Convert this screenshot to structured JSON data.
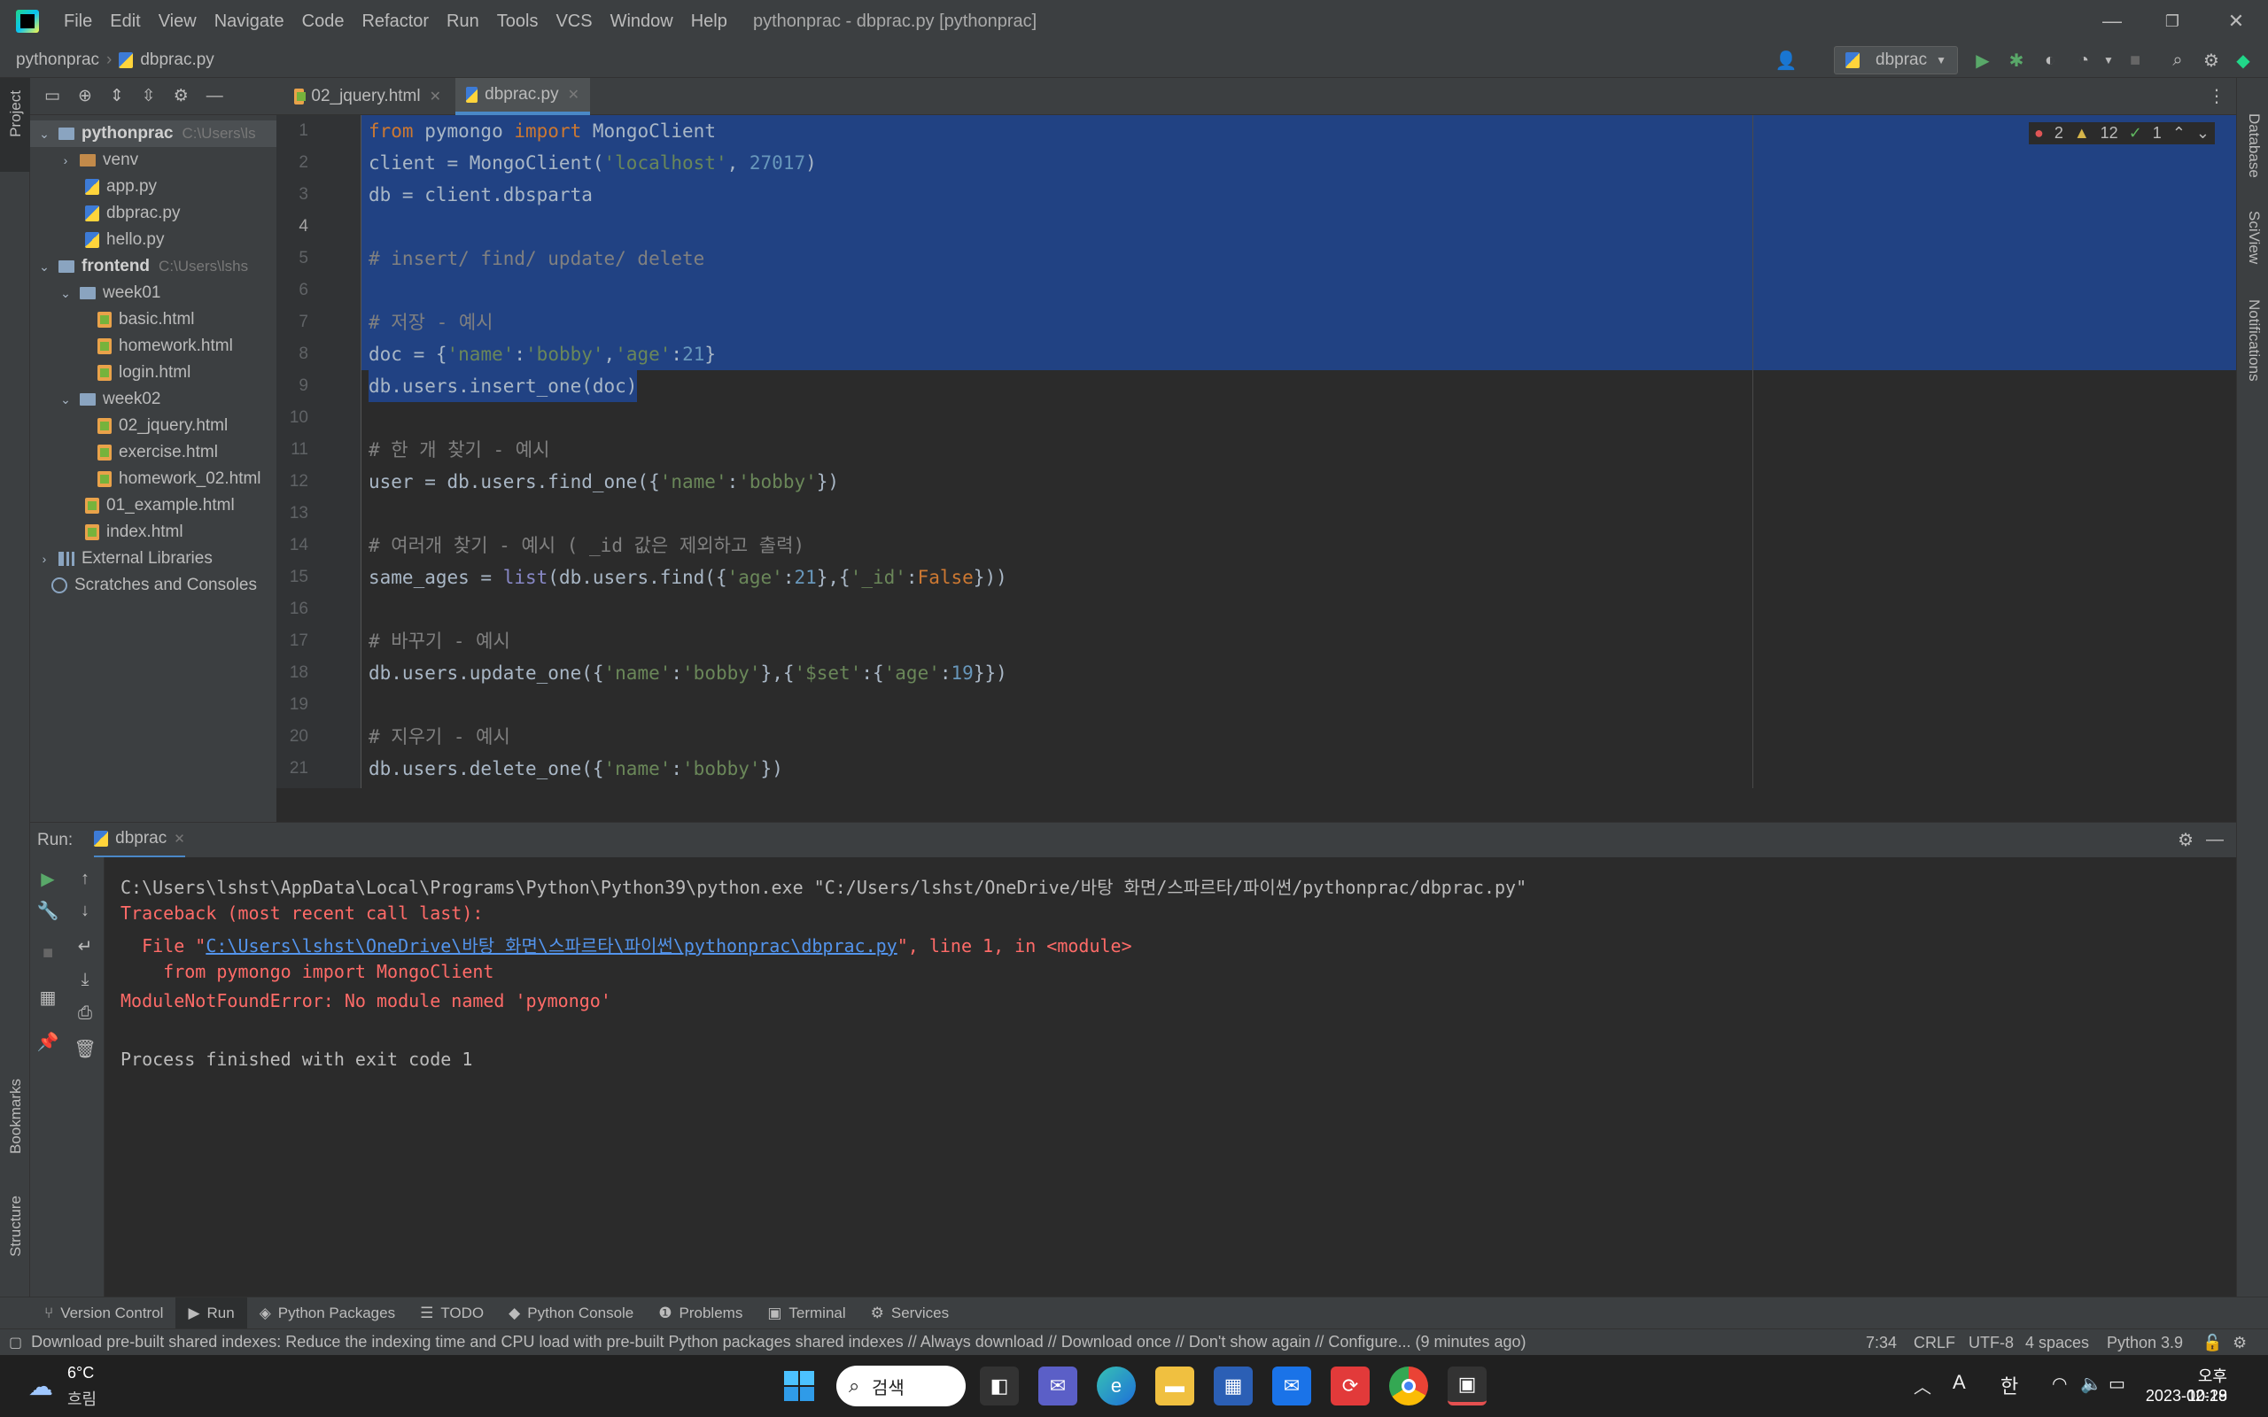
{
  "window": {
    "menu": [
      "File",
      "Edit",
      "View",
      "Navigate",
      "Code",
      "Refactor",
      "Run",
      "Tools",
      "VCS",
      "Window",
      "Help"
    ],
    "title": "pythonprac - dbprac.py [pythonprac]",
    "minimize": "—",
    "restore": "❐",
    "close": "✕"
  },
  "navbar": {
    "project": "pythonprac",
    "separator": "›",
    "file": "dbprac.py",
    "run_config": "dbprac"
  },
  "left_strip": {
    "project": "Project",
    "bookmarks": "Bookmarks",
    "structure": "Structure"
  },
  "right_strip": {
    "database": "Database",
    "sciview": "SciView",
    "notifications": "Notifications"
  },
  "project_tree": [
    {
      "name": "pythonprac",
      "hint": "C:\\Users\\ls",
      "type": "folder",
      "arrow": "v",
      "level": 0,
      "bold": true,
      "selected": true
    },
    {
      "name": "venv",
      "hint": "",
      "type": "folder-orange",
      "arrow": ">",
      "level": 1
    },
    {
      "name": "app.py",
      "hint": "",
      "type": "py",
      "arrow": "",
      "level": 2
    },
    {
      "name": "dbprac.py",
      "hint": "",
      "type": "py",
      "arrow": "",
      "level": 2
    },
    {
      "name": "hello.py",
      "hint": "",
      "type": "py",
      "arrow": "",
      "level": 2
    },
    {
      "name": "frontend",
      "hint": "C:\\Users\\lshs",
      "type": "folder",
      "arrow": "v",
      "level": 0,
      "bold": true
    },
    {
      "name": "week01",
      "hint": "",
      "type": "folder",
      "arrow": "v",
      "level": 1
    },
    {
      "name": "basic.html",
      "hint": "",
      "type": "html",
      "arrow": "",
      "level": 3
    },
    {
      "name": "homework.html",
      "hint": "",
      "type": "html",
      "arrow": "",
      "level": 3
    },
    {
      "name": "login.html",
      "hint": "",
      "type": "html",
      "arrow": "",
      "level": 3
    },
    {
      "name": "week02",
      "hint": "",
      "type": "folder",
      "arrow": "v",
      "level": 1
    },
    {
      "name": "02_jquery.html",
      "hint": "",
      "type": "html",
      "arrow": "",
      "level": 3
    },
    {
      "name": "exercise.html",
      "hint": "",
      "type": "html",
      "arrow": "",
      "level": 3
    },
    {
      "name": "homework_02.html",
      "hint": "",
      "type": "html",
      "arrow": "",
      "level": 3
    },
    {
      "name": "01_example.html",
      "hint": "",
      "type": "html",
      "arrow": "",
      "level": 2
    },
    {
      "name": "index.html",
      "hint": "",
      "type": "html",
      "arrow": "",
      "level": 2
    },
    {
      "name": "External Libraries",
      "hint": "",
      "type": "extlib",
      "arrow": ">",
      "level": 0
    },
    {
      "name": "Scratches and Consoles",
      "hint": "",
      "type": "scratch",
      "arrow": "",
      "level": 0
    }
  ],
  "tabs": [
    {
      "label": "02_jquery.html",
      "active": false
    },
    {
      "label": "dbprac.py",
      "active": true
    }
  ],
  "inspections": {
    "errors": "2",
    "warnings": "12",
    "ok": "1"
  },
  "code_lines": [
    {
      "n": "1",
      "sel": true,
      "tokens": [
        [
          "kw",
          "from "
        ],
        [
          "id",
          "pymongo "
        ],
        [
          "kw",
          "import "
        ],
        [
          "id",
          "MongoClient"
        ]
      ]
    },
    {
      "n": "2",
      "sel": true,
      "tokens": [
        [
          "id",
          "client = MongoClient("
        ],
        [
          "str",
          "'localhost'"
        ],
        [
          "id",
          ", "
        ],
        [
          "num",
          "27017"
        ],
        [
          "id",
          ")"
        ]
      ]
    },
    {
      "n": "3",
      "sel": true,
      "tokens": [
        [
          "id",
          "db = client.dbsparta"
        ]
      ]
    },
    {
      "n": "4",
      "sel": true,
      "tokens": []
    },
    {
      "n": "5",
      "sel": true,
      "tokens": [
        [
          "cm",
          "# insert/ find/ update/ delete"
        ]
      ]
    },
    {
      "n": "6",
      "sel": true,
      "tokens": []
    },
    {
      "n": "7",
      "sel": true,
      "tokens": [
        [
          "cm",
          "# 저장 - 예시"
        ]
      ]
    },
    {
      "n": "8",
      "sel": true,
      "tokens": [
        [
          "id",
          "doc = {"
        ],
        [
          "str",
          "'name'"
        ],
        [
          "id",
          ":"
        ],
        [
          "str",
          "'bobby'"
        ],
        [
          "id",
          ","
        ],
        [
          "str",
          "'age'"
        ],
        [
          "id",
          ":"
        ],
        [
          "num",
          "21"
        ],
        [
          "id",
          "}"
        ]
      ]
    },
    {
      "n": "9",
      "sel": "partial",
      "tokens": [
        [
          "id",
          "db.users.insert_one(doc)"
        ]
      ]
    },
    {
      "n": "10",
      "sel": false,
      "tokens": []
    },
    {
      "n": "11",
      "sel": false,
      "tokens": [
        [
          "cm",
          "# 한 개 찾기 - 예시"
        ]
      ]
    },
    {
      "n": "12",
      "sel": false,
      "tokens": [
        [
          "id",
          "user = db.users.find_one({"
        ],
        [
          "str",
          "'name'"
        ],
        [
          "id",
          ":"
        ],
        [
          "str",
          "'bobby'"
        ],
        [
          "id",
          "})"
        ]
      ]
    },
    {
      "n": "13",
      "sel": false,
      "tokens": []
    },
    {
      "n": "14",
      "sel": false,
      "tokens": [
        [
          "cm",
          "# 여러개 찾기 - 예시 ( _id 값은 제외하고 출력)"
        ]
      ]
    },
    {
      "n": "15",
      "sel": false,
      "tokens": [
        [
          "id",
          "same_ages = "
        ],
        [
          "fn",
          "list"
        ],
        [
          "id",
          "(db.users.find({"
        ],
        [
          "str",
          "'age'"
        ],
        [
          "id",
          ":"
        ],
        [
          "num",
          "21"
        ],
        [
          "id",
          "},{"
        ],
        [
          "str",
          "'_id'"
        ],
        [
          "id",
          ":"
        ],
        [
          "kw",
          "False"
        ],
        [
          "id",
          "}))"
        ]
      ]
    },
    {
      "n": "16",
      "sel": false,
      "tokens": []
    },
    {
      "n": "17",
      "sel": false,
      "tokens": [
        [
          "cm",
          "# 바꾸기 - 예시"
        ]
      ]
    },
    {
      "n": "18",
      "sel": false,
      "tokens": [
        [
          "id",
          "db.users.update_one({"
        ],
        [
          "str",
          "'name'"
        ],
        [
          "id",
          ":"
        ],
        [
          "str",
          "'bobby'"
        ],
        [
          "id",
          "},{"
        ],
        [
          "str",
          "'$set'"
        ],
        [
          "id",
          ":{"
        ],
        [
          "str",
          "'age'"
        ],
        [
          "id",
          ":"
        ],
        [
          "num",
          "19"
        ],
        [
          "id",
          "}})"
        ]
      ]
    },
    {
      "n": "19",
      "sel": false,
      "tokens": []
    },
    {
      "n": "20",
      "sel": false,
      "tokens": [
        [
          "cm",
          "# 지우기 - 예시"
        ]
      ]
    },
    {
      "n": "21",
      "sel": false,
      "tokens": [
        [
          "id",
          "db.users.delete_one({"
        ],
        [
          "str",
          "'name'"
        ],
        [
          "id",
          ":"
        ],
        [
          "str",
          "'bobby'"
        ],
        [
          "id",
          "})"
        ]
      ]
    }
  ],
  "run_panel": {
    "label": "Run:",
    "tab": "dbprac",
    "console": [
      {
        "cls": "out",
        "parts": [
          [
            "out",
            "C:\\Users\\lshst\\AppData\\Local\\Programs\\Python\\Python39\\python.exe \"C:/Users/lshst/OneDrive/바탕 화면/스파르타/파이썬/pythonprac/dbprac.py\""
          ]
        ]
      },
      {
        "cls": "err",
        "parts": [
          [
            "err",
            "Traceback (most recent call last):"
          ]
        ]
      },
      {
        "cls": "err",
        "parts": [
          [
            "err",
            "  File \""
          ],
          [
            "link",
            "C:\\Users\\lshst\\OneDrive\\바탕 화면\\스파르타\\파이썬\\pythonprac\\dbprac.py"
          ],
          [
            "err",
            "\", line 1, in <module>"
          ]
        ]
      },
      {
        "cls": "err",
        "parts": [
          [
            "err",
            "    from pymongo import MongoClient"
          ]
        ]
      },
      {
        "cls": "err",
        "parts": [
          [
            "err",
            "ModuleNotFoundError: No module named 'pymongo'"
          ]
        ]
      },
      {
        "cls": "out",
        "parts": [
          [
            "out",
            ""
          ]
        ]
      },
      {
        "cls": "out",
        "parts": [
          [
            "out",
            "Process finished with exit code 1"
          ]
        ]
      }
    ]
  },
  "bottom_tools": [
    {
      "label": "Version Control",
      "icon": "⑂",
      "active": false
    },
    {
      "label": "Run",
      "icon": "▶",
      "active": true
    },
    {
      "label": "Python Packages",
      "icon": "◈",
      "active": false
    },
    {
      "label": "TODO",
      "icon": "☰",
      "active": false
    },
    {
      "label": "Python Console",
      "icon": "◆",
      "active": false
    },
    {
      "label": "Problems",
      "icon": "❶",
      "active": false
    },
    {
      "label": "Terminal",
      "icon": "▣",
      "active": false
    },
    {
      "label": "Services",
      "icon": "⚙",
      "active": false
    }
  ],
  "status": {
    "message": "Download pre-built shared indexes: Reduce the indexing time and CPU load with pre-built Python packages shared indexes // Always download // Download once // Don't show again // Configure... (9 minutes ago)",
    "position": "7:34",
    "line_sep": "CRLF",
    "encoding": "UTF-8",
    "indent": "4 spaces",
    "interpreter": "Python 3.9"
  },
  "taskbar": {
    "weather_temp": "6°C",
    "weather_desc": "흐림",
    "search": "검색",
    "ime_a": "A",
    "ime_han": "한",
    "time": "오후 10:19",
    "date": "2023-02-28"
  }
}
